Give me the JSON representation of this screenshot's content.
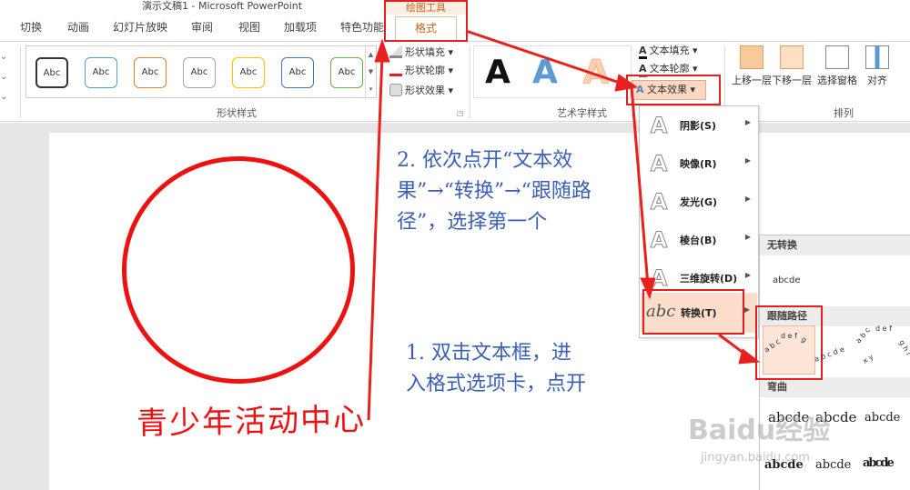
{
  "window": {
    "title": "演示文稿1 - Microsoft PowerPoint"
  },
  "tabs": [
    "切换",
    "动画",
    "幻灯片放映",
    "审阅",
    "视图",
    "加载项",
    "特色功能"
  ],
  "context_tab": {
    "group": "绘图工具",
    "tab": "格式"
  },
  "shape_styles": {
    "label": "形状样式",
    "items": [
      "Abc",
      "Abc",
      "Abc",
      "Abc",
      "Abc",
      "Abc",
      "Abc"
    ],
    "fill": "形状填充",
    "outline": "形状轮廓",
    "effects": "形状效果"
  },
  "wordart": {
    "label": "艺术字样式",
    "samples": [
      "A",
      "A",
      "A"
    ],
    "text_fill": "文本填充",
    "text_outline": "文本轮廓",
    "text_effects": "文本效果"
  },
  "arrange": {
    "label": "排列",
    "bring_forward": "上移一层",
    "send_backward": "下移一层",
    "selection_pane": "选择窗格",
    "align": "对齐"
  },
  "effects_menu": {
    "items": [
      "阴影(S)",
      "映像(R)",
      "发光(G)",
      "棱台(B)",
      "三维旋转(D)",
      "转换(T)"
    ]
  },
  "transform_submenu": {
    "no_transform_header": "无转换",
    "no_transform_sample": "abcde",
    "follow_path_header": "跟随路径",
    "warp_header": "弯曲",
    "warp_samples": [
      "abcde",
      "abcde",
      "abcde",
      "abcde",
      "abcde",
      "abcde"
    ]
  },
  "slide": {
    "circle_text": "青少年活动中心"
  },
  "annotations": {
    "step1": "1. 双击文本框，进入格式选项卡，点开",
    "step2": "2. 依次点开“文本效果”→“转换”→“跟随路径”，选择第一个"
  },
  "watermark": {
    "brand": "Baidu经验",
    "url": "jingyan.baidu.com"
  },
  "colors": {
    "highlight_red": "#e02020",
    "annotation_blue": "#3b5fb8",
    "accent_orange": "#c8641e"
  }
}
